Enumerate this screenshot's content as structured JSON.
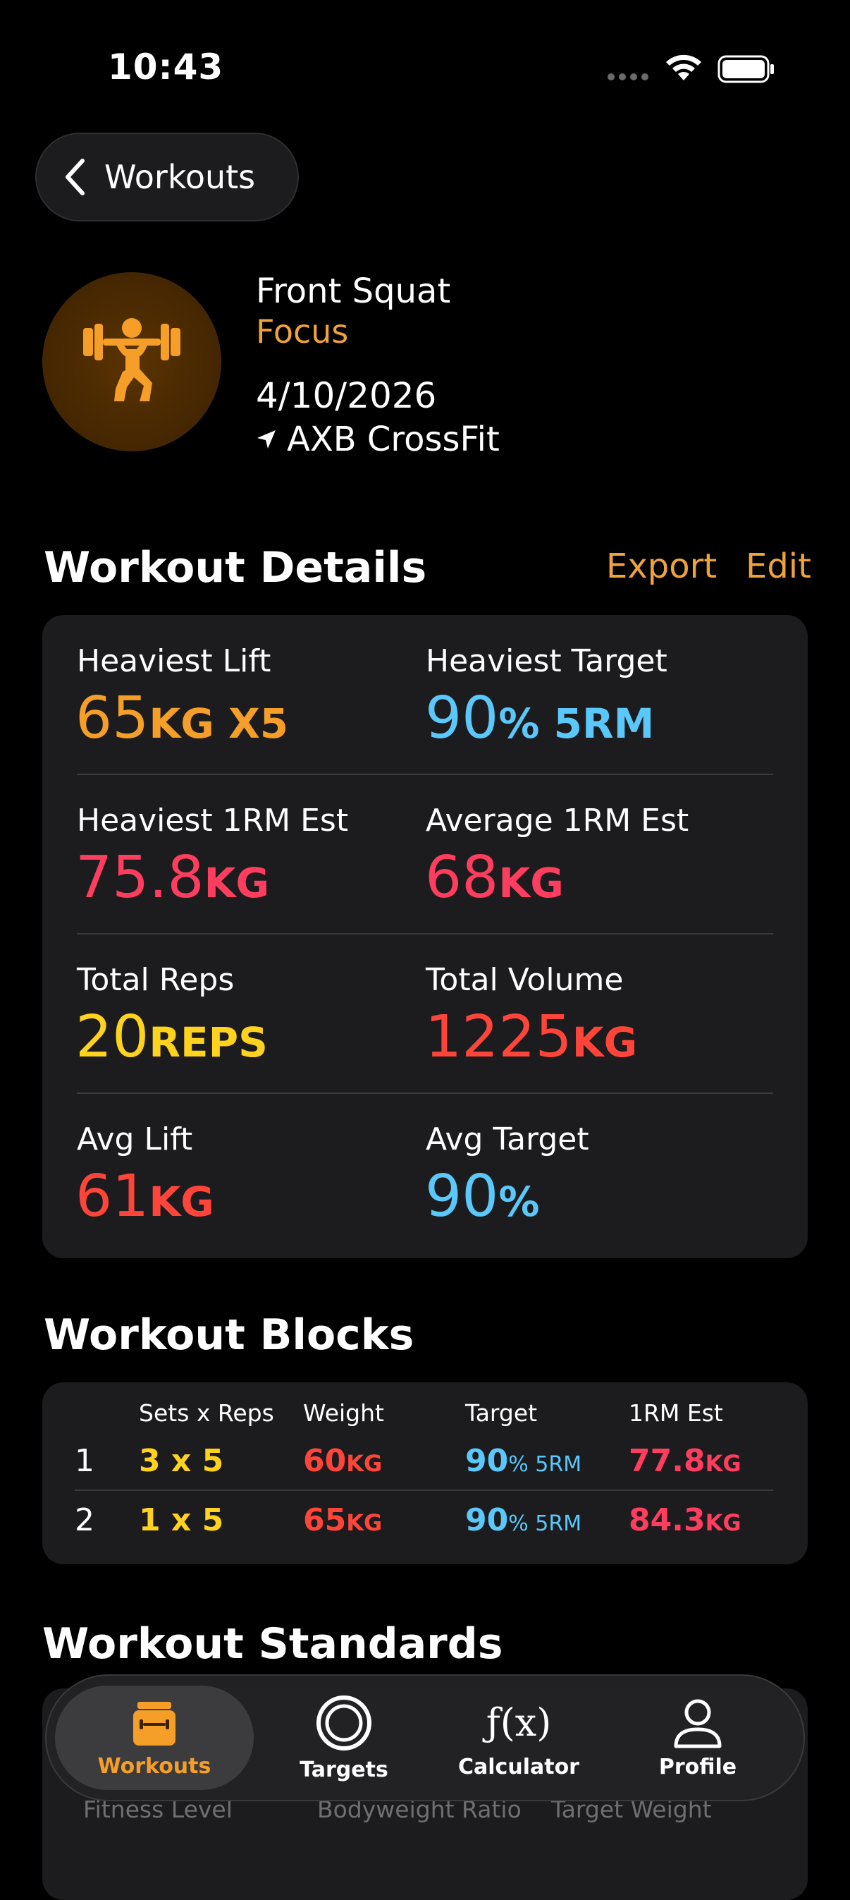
{
  "status_bar": {
    "time": "10:43"
  },
  "nav": {
    "back_label": "Workouts"
  },
  "header": {
    "exercise": "Front Squat",
    "category": "Focus",
    "date": "4/10/2026",
    "location": "AXB CrossFit",
    "icon": "weightlifting-icon"
  },
  "details": {
    "title": "Workout Details",
    "export_label": "Export",
    "edit_label": "Edit",
    "stats": [
      {
        "label": "Heaviest Lift",
        "value": "65",
        "unit": "KG X5",
        "color": "#f59e28"
      },
      {
        "label": "Heaviest Target",
        "value": "90",
        "unit": "% 5RM",
        "color": "#5ac8fa"
      },
      {
        "label": "Heaviest 1RM Est",
        "value": "75.8",
        "unit": "KG",
        "color": "#ff3d5f"
      },
      {
        "label": "Average 1RM Est",
        "value": "68",
        "unit": "KG",
        "color": "#ff3d5f"
      },
      {
        "label": "Total Reps",
        "value": "20",
        "unit": "REPS",
        "color": "#ffd21e"
      },
      {
        "label": "Total Volume",
        "value": "1225",
        "unit": "KG",
        "color": "#ff453a"
      },
      {
        "label": "Avg Lift",
        "value": "61",
        "unit": "KG",
        "color": "#ff453a"
      },
      {
        "label": "Avg Target",
        "value": "90",
        "unit": "%",
        "color": "#5ac8fa"
      }
    ]
  },
  "blocks": {
    "title": "Workout Blocks",
    "columns": [
      "Sets x Reps",
      "Weight",
      "Target",
      "1RM Est"
    ],
    "rows": [
      {
        "index": "1",
        "sets_reps": "3 x 5",
        "weight": "60",
        "weight_unit": "KG",
        "target": "90",
        "target_unit": "% 5RM",
        "est": "77.8",
        "est_unit": "KG"
      },
      {
        "index": "2",
        "sets_reps": "1 x 5",
        "weight": "65",
        "weight_unit": "KG",
        "target": "90",
        "target_unit": "% 5RM",
        "est": "84.3",
        "est_unit": "KG"
      }
    ]
  },
  "standards": {
    "title": "Workout Standards",
    "columns": [
      "Fitness Level",
      "Bodyweight Ratio",
      "Target Weight"
    ]
  },
  "tabbar": {
    "tabs": [
      {
        "label": "Workouts",
        "icon": "workouts-icon",
        "active": true
      },
      {
        "label": "Targets",
        "icon": "target-icon",
        "active": false
      },
      {
        "label": "Calculator",
        "icon": "function-icon",
        "active": false
      },
      {
        "label": "Profile",
        "icon": "profile-icon",
        "active": false
      }
    ]
  },
  "colors": {
    "accent": "#f0a33a",
    "background": "#000000",
    "card": "#1c1c1e"
  }
}
